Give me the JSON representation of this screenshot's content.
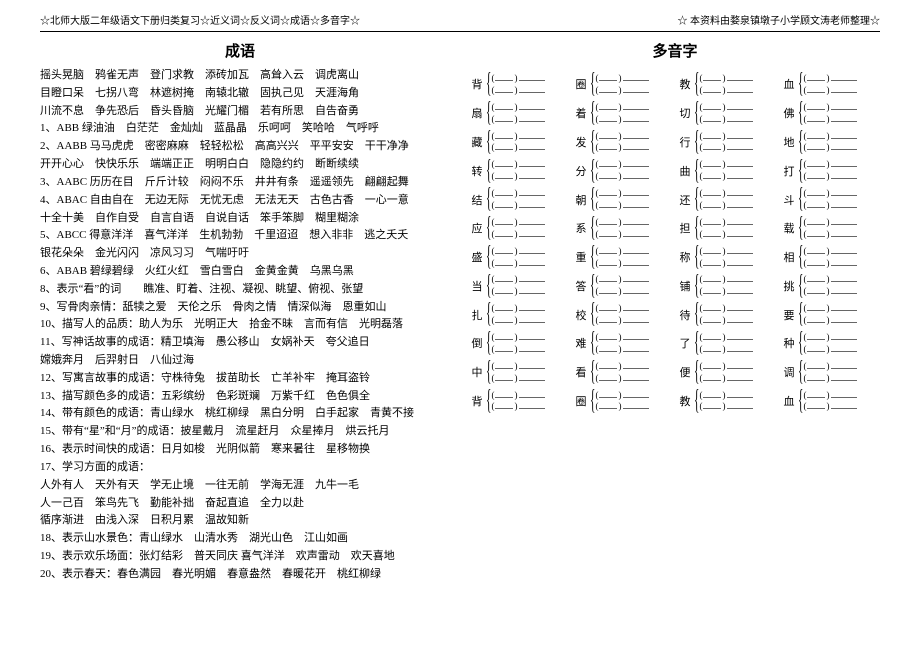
{
  "header": {
    "left": "☆北师大版二年级语文下册归类复习☆近义词☆反义词☆成语☆多音字☆",
    "right": "☆ 本资料由婺泉镇墩子小学顾文涛老师整理☆"
  },
  "left": {
    "title": "成语",
    "lines": [
      "摇头晃脑　鸦雀无声　登门求教　添砖加瓦　高耸入云　调虎离山",
      "目瞪口呆　七拐八弯　林遮树掩　南辕北辙　固执己见　天涯海角",
      "川流不息　争先恐后　昏头昏脑　光耀门楣　若有所思　自告奋勇",
      "1、ABB   绿油油　白茫茫　金灿灿　蓝晶晶　乐呵呵　笑哈哈　气呼呼",
      "2、AABB 马马虎虎　密密麻麻　轻轻松松　高高兴兴　平平安安　干干净净",
      "            开开心心　快快乐乐　端端正正　明明白白　隐隐约约　断断续续",
      "3、AABC 历历在目　斤斤计较　闷闷不乐　井井有条　遥遥领先　翩翩起舞",
      "4、ABAC 自由自在　无边无际　无忧无虑　无法无天　古色古香　一心一意",
      "            十全十美　自作自受　自言自语　自说自话　笨手笨脚　糊里糊涂",
      "5、ABCC 得意洋洋　喜气洋洋　生机勃勃　千里迢迢　想入非非　逃之夭夭",
      "            银花朵朵　金光闪闪　凉风习习　气喘吁吁",
      "6、ABAB 碧绿碧绿　火红火红　雪白雪白　金黄金黄　乌黑乌黑",
      "8、表示“看”的词　　瞧准、盯着、注视、凝视、眺望、俯视、张望",
      "9、写骨肉亲情：舐犊之爱　天伦之乐　骨肉之情　情深似海　恩重如山",
      "10、描写人的品质：助人为乐　光明正大　拾金不昧　言而有信　光明磊落",
      "11、写神话故事的成语：精卫填海　愚公移山　女娲补天　夸父追日",
      "                              嫦娥奔月　后羿射日　八仙过海",
      "12、写寓言故事的成语：守株待兔　拔苗助长　亡羊补牢　掩耳盗铃",
      "13、描写颜色多的成语：五彩缤纷　色彩斑斓　万紫千红　色色俱全",
      "14、带有颜色的成语：青山绿水　桃红柳绿　黑白分明　白手起家　青黄不接",
      "15、带有“星”和“月”的成语：披星戴月　流星赶月　众星捧月　烘云托月",
      "16、表示时间快的成语：日月如梭　光阴似箭　寒来暑往　星移物换",
      "17、学习方面的成语：",
      "人外有人　天外有天　学无止境　一往无前　学海无涯　九牛一毛",
      "人一己百　笨鸟先飞　勤能补拙　奋起直追　全力以赴",
      "循序渐进　由浅入深　日积月累　温故知新",
      "18、表示山水景色：青山绿水　山清水秀　湖光山色　江山如画",
      "19、表示欢乐场面：张灯结彩　普天同庆 喜气洋洋　欢声雷动　欢天喜地",
      "20、表示春天：春色满园　春光明媚　春意盎然　春暖花开　桃红柳绿"
    ]
  },
  "right": {
    "title": "多音字",
    "rows": [
      [
        "背",
        "圈",
        "教",
        "血"
      ],
      [
        "扇",
        "着",
        "切",
        "佛"
      ],
      [
        "藏",
        "发",
        "行",
        "地"
      ],
      [
        "转",
        "分",
        "曲",
        "打"
      ],
      [
        "结",
        "朝",
        "还",
        "斗"
      ],
      [
        "应",
        "系",
        "担",
        "载"
      ],
      [
        "盛",
        "重",
        "称",
        "相"
      ],
      [
        "当",
        "答",
        "铺",
        "挑"
      ],
      [
        "扎",
        "校",
        "待",
        "要"
      ],
      [
        "倒",
        "难",
        "了",
        "种"
      ],
      [
        "中",
        "看",
        "便",
        "调"
      ],
      [
        "背",
        "圈",
        "教",
        "血"
      ]
    ]
  }
}
